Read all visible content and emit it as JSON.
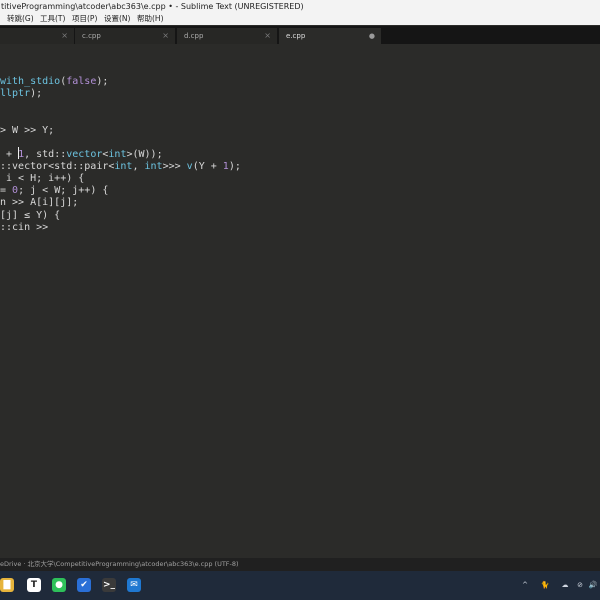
{
  "window": {
    "title": "titiveProgramming\\atcoder\\abc363\\e.cpp • - Sublime Text (UNREGISTERED)"
  },
  "menu": {
    "items": [
      "转跳(G)",
      "工具(T)",
      "项目(P)",
      "设置(N)",
      "帮助(H)"
    ]
  },
  "tabs": [
    {
      "label": "",
      "close": "×"
    },
    {
      "label": "c.cpp",
      "close": "×"
    },
    {
      "label": "d.cpp",
      "close": "×"
    },
    {
      "label": "e.cpp",
      "close": "●"
    }
  ],
  "editor": {
    "lines": [
      {
        "tokens": [
          {
            "t": "with_stdio",
            "c": "#6cc3e0"
          },
          {
            "t": "(",
            "c": "#d8d8d8"
          },
          {
            "t": "false",
            "c": "#b391d8"
          },
          {
            "t": ");",
            "c": "#d8d8d8"
          }
        ]
      },
      {
        "tokens": [
          {
            "t": "llptr",
            "c": "#6cc3e0"
          },
          {
            "t": ");",
            "c": "#d8d8d8"
          }
        ]
      },
      {
        "tokens": [
          {
            "t": "",
            "c": "#d8d8d8"
          }
        ]
      },
      {
        "tokens": [
          {
            "t": "",
            "c": "#d8d8d8"
          }
        ]
      },
      {
        "tokens": [
          {
            "t": "> W >> Y;",
            "c": "#d8d8d8"
          }
        ]
      },
      {
        "tokens": [
          {
            "t": "",
            "c": "#d8d8d8"
          }
        ]
      },
      {
        "tokens": [
          {
            "t": " + ",
            "c": "#d8d8d8"
          },
          {
            "t": "1",
            "c": "#b391d8"
          },
          {
            "t": ", std::",
            "c": "#d8d8d8"
          },
          {
            "t": "vector",
            "c": "#6cc3e0"
          },
          {
            "t": "<",
            "c": "#d8d8d8"
          },
          {
            "t": "int",
            "c": "#6cc3e0"
          },
          {
            "t": ">(W));",
            "c": "#d8d8d8"
          }
        ]
      },
      {
        "tokens": [
          {
            "t": "::vector<std::pair<",
            "c": "#d8d8d8"
          },
          {
            "t": "int",
            "c": "#6cc3e0"
          },
          {
            "t": ", ",
            "c": "#d8d8d8"
          },
          {
            "t": "int",
            "c": "#6cc3e0"
          },
          {
            "t": ">>> ",
            "c": "#d8d8d8"
          },
          {
            "t": "v",
            "c": "#6cc3e0"
          },
          {
            "t": "(Y + ",
            "c": "#d8d8d8"
          },
          {
            "t": "1",
            "c": "#b391d8"
          },
          {
            "t": ");",
            "c": "#d8d8d8"
          }
        ]
      },
      {
        "tokens": [
          {
            "t": " i < H; i++) {",
            "c": "#d8d8d8"
          }
        ]
      },
      {
        "tokens": [
          {
            "t": "= ",
            "c": "#d8d8d8"
          },
          {
            "t": "0",
            "c": "#b391d8"
          },
          {
            "t": "; j < W; j++) {",
            "c": "#d8d8d8"
          }
        ]
      },
      {
        "tokens": [
          {
            "t": "n >> A[i][j];",
            "c": "#d8d8d8"
          }
        ]
      },
      {
        "tokens": [
          {
            "t": "[j] ≤ Y) {",
            "c": "#d8d8d8"
          }
        ]
      },
      {
        "tokens": [
          {
            "t": "::cin >>",
            "c": "#d8d8d8"
          }
        ]
      }
    ]
  },
  "status": {
    "text": "eDrive · 北京大学\\CompetitiveProgramming\\atcoder\\abc363\\e.cpp (UTF-8)"
  },
  "taskbar": {
    "apps": [
      {
        "name": "file-explorer-icon",
        "glyph": "▇",
        "bg": "#e6b43c"
      },
      {
        "name": "typora-icon",
        "glyph": "T",
        "bg": "#ffffff",
        "fg": "#222"
      },
      {
        "name": "wechat-icon",
        "glyph": "●",
        "bg": "#2ec15a"
      },
      {
        "name": "todo-icon",
        "glyph": "✔",
        "bg": "#2a6fd6"
      },
      {
        "name": "terminal-icon",
        "glyph": ">_",
        "bg": "#3a3a3a"
      },
      {
        "name": "outlook-icon",
        "glyph": "✉",
        "bg": "#1f78d1"
      }
    ],
    "tray": [
      "^",
      "🐈",
      "☁",
      "⊘",
      "🔊"
    ]
  }
}
